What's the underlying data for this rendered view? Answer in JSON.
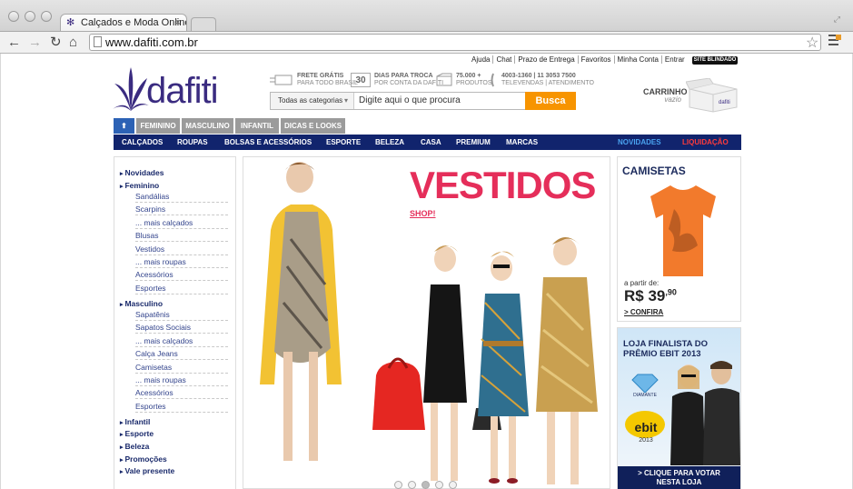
{
  "browser": {
    "tab_title": "Calçados e Moda Online –",
    "tab_close": "×",
    "url": "www.dafiti.com.br"
  },
  "header": {
    "top_links": [
      "Ajuda",
      "Chat",
      "Prazo de Entrega",
      "Favoritos",
      "Minha Conta",
      "Entrar"
    ],
    "site_blindado": "SITE BLINDADO",
    "logo": "dafiti",
    "features": [
      {
        "title": "FRETE GRÁTIS",
        "sub": "PARA TODO BRASIL"
      },
      {
        "title": "DIAS PARA TROCA",
        "sub": "POR CONTA DA DAFITI",
        "number": "30"
      },
      {
        "title": "75.000 +",
        "sub": "PRODUTOS"
      },
      {
        "title": "4003-1360 | 11 3053 7500",
        "sub": "TELEVENDAS | ATENDIMENTO"
      }
    ],
    "search": {
      "category": "Todas as categorias",
      "placeholder": "Digite aqui o que procura",
      "button": "Busca"
    },
    "cart": {
      "label": "CARRINHO",
      "status": "vazio"
    }
  },
  "tabs": [
    "FEMININO",
    "MASCULINO",
    "INFANTIL",
    "DICAS E LOOKS"
  ],
  "categories": [
    "CALÇADOS",
    "ROUPAS",
    "BOLSAS E ACESSÓRIOS",
    "ESPORTE",
    "BELEZA",
    "CASA",
    "PREMIUM",
    "MARCAS"
  ],
  "categories_right": [
    "NOVIDADES",
    "LIQUIDAÇÃO"
  ],
  "colors": {
    "brand": "#3a2b80",
    "navbar": "#11246d",
    "search_button": "#f79400",
    "accent_red": "#e52e5a",
    "novidades": "#4aa3f0",
    "liquidacao": "#ff3b3b"
  },
  "sidebar": {
    "novidades": "Novidades",
    "feminino": "Feminino",
    "feminino_items": [
      "Sandálias",
      "Scarpins",
      "... mais calçados",
      "Blusas",
      "Vestidos",
      "... mais roupas",
      "Acessórios",
      "Esportes"
    ],
    "masculino": "Masculino",
    "masculino_items": [
      "Sapatênis",
      "Sapatos Sociais",
      "... mais calçados",
      "Calça Jeans",
      "Camisetas",
      "... mais roupas",
      "Acessórios",
      "Esportes"
    ],
    "bottom": [
      "Infantil",
      "Esporte",
      "Beleza",
      "Promoções",
      "Vale presente"
    ]
  },
  "banner": {
    "headline": "VESTIDOS",
    "cta": "SHOP!"
  },
  "promo_camisetas": {
    "title": "CAMISETAS",
    "from": "a partir de:",
    "price": "R$ 39",
    "cents": ",90",
    "cta": "> CONFIRA"
  },
  "promo_ebit": {
    "title": "LOJA FINALISTA DO PRÊMIO EBIT 2013",
    "diamante": "DIAMANTE",
    "ebit": "ebit",
    "year": "2013",
    "cta1": "> CLIQUE PARA VOTAR",
    "cta2": "NESTA LOJA"
  }
}
